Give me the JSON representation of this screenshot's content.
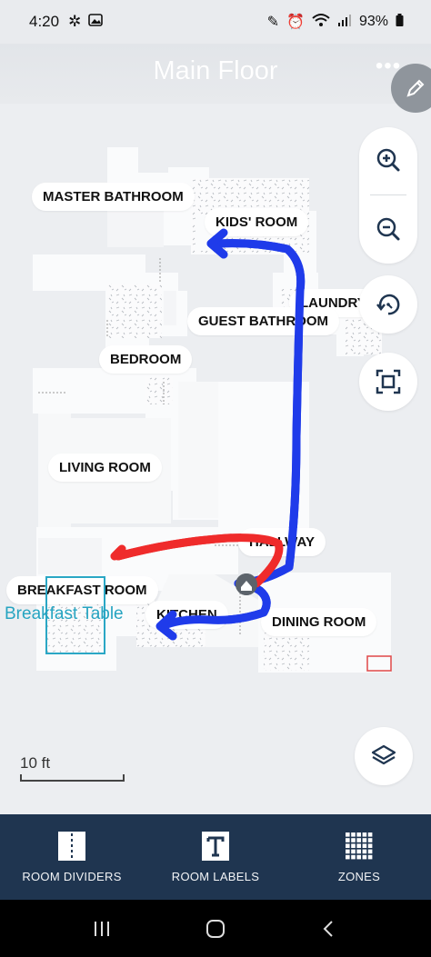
{
  "status_bar": {
    "time": "4:20",
    "battery": "93%"
  },
  "header": {
    "title": "Main Floor",
    "more_icon": "more-horizontal-icon",
    "edit_icon": "pencil-icon"
  },
  "rooms": [
    {
      "id": "master-bathroom",
      "label": "MASTER BATHROOM"
    },
    {
      "id": "kids-room",
      "label": "KIDS' ROOM"
    },
    {
      "id": "laundry",
      "label": "LAUNDRY"
    },
    {
      "id": "guest-bathroom",
      "label": "GUEST BATHROOM"
    },
    {
      "id": "bedroom",
      "label": "BEDROOM"
    },
    {
      "id": "living-room",
      "label": "LIVING ROOM"
    },
    {
      "id": "hallway",
      "label": "HALLWAY"
    },
    {
      "id": "breakfast-room",
      "label": "BREAKFAST ROOM"
    },
    {
      "id": "kitchen",
      "label": "KITCHEN"
    },
    {
      "id": "dining-room",
      "label": "DINING ROOM"
    }
  ],
  "annotations": {
    "breakfast_table": "Breakfast Table"
  },
  "map_controls": {
    "zoom_in_icon": "zoom-in-icon",
    "zoom_out_icon": "zoom-out-icon",
    "rotate_icon": "rotate-icon",
    "fit_icon": "fit-screen-icon",
    "layers_icon": "layers-icon"
  },
  "scale": {
    "label": "10 ft"
  },
  "toolbar": {
    "items": [
      {
        "label": "ROOM DIVIDERS",
        "icon": "room-dividers-icon"
      },
      {
        "label": "ROOM LABELS",
        "icon": "room-labels-icon"
      },
      {
        "label": "ZONES",
        "icon": "zones-grid-icon"
      }
    ]
  },
  "colors": {
    "toolbar_bg": "#1f3550",
    "path_blue": "#1f3bea",
    "path_red": "#ef2b2b",
    "annotation_cyan": "#26a4c1"
  }
}
